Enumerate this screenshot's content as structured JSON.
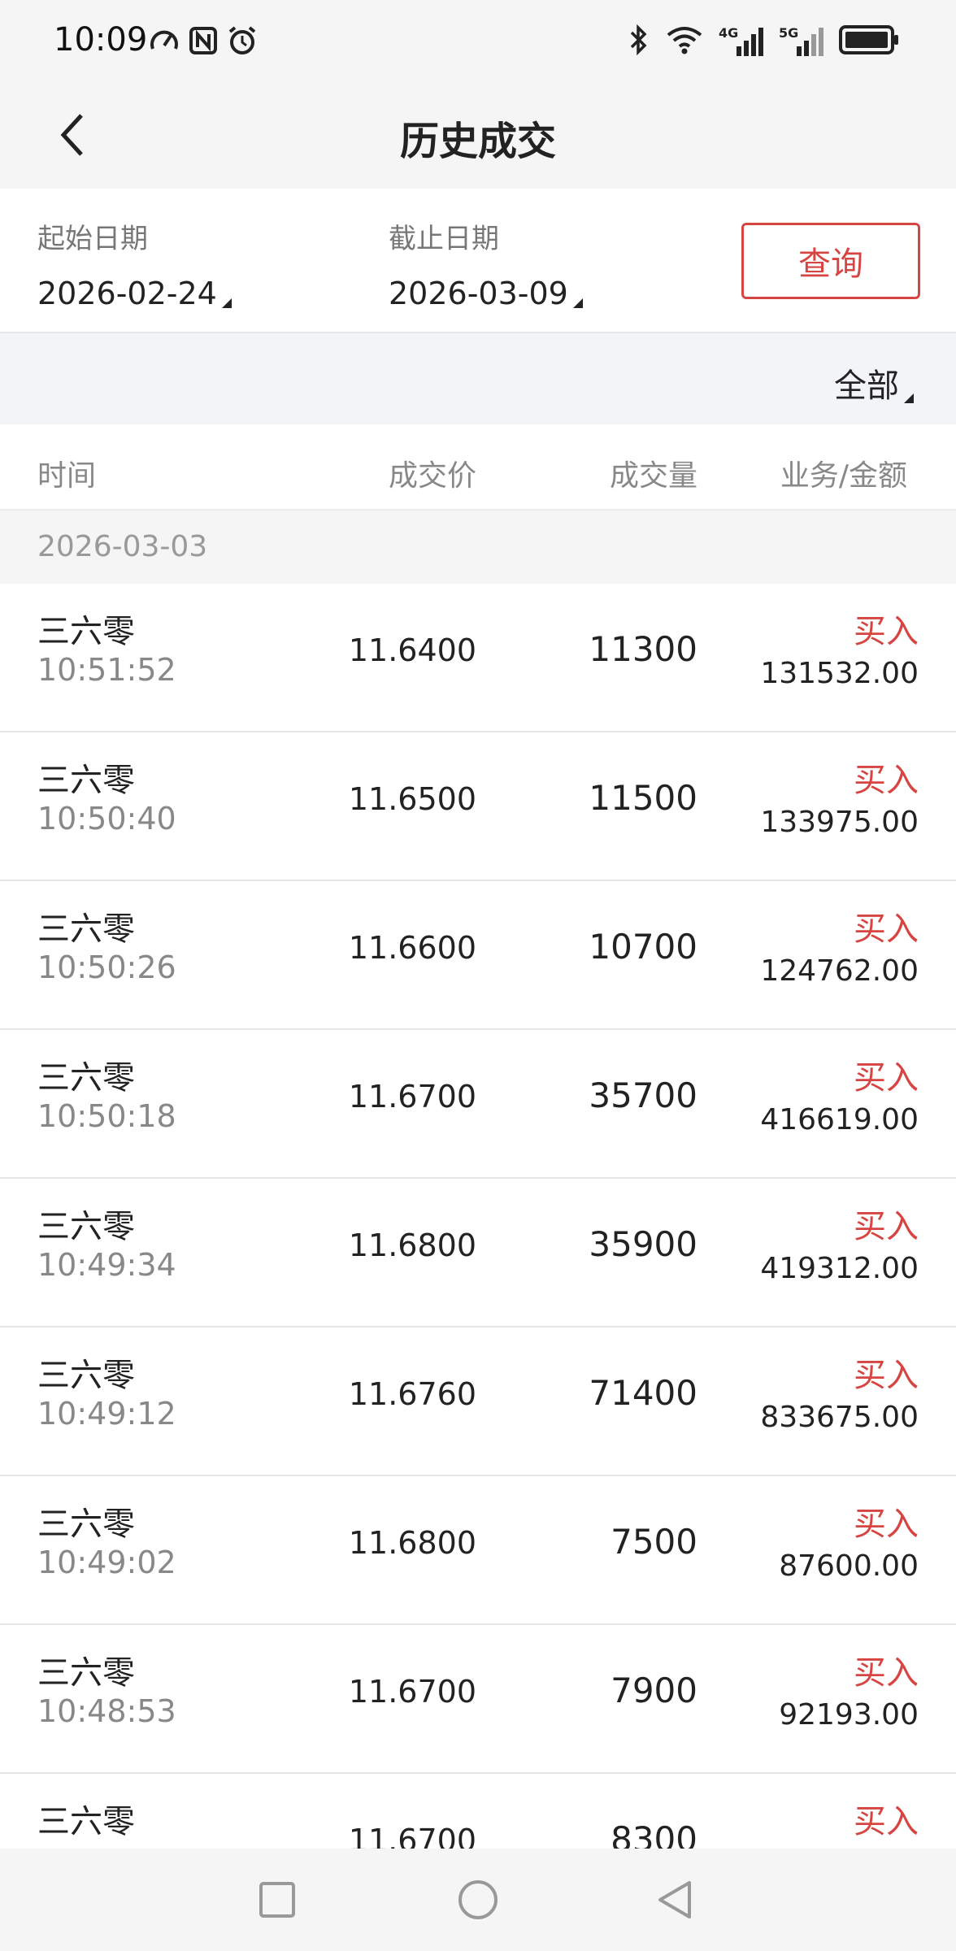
{
  "status_bar": {
    "time": "10:09",
    "icons_left": [
      "speedometer-icon",
      "nfc-icon",
      "alarm-icon"
    ],
    "icons_right": [
      "bluetooth-icon",
      "wifi-icon",
      "signal-4g-icon",
      "signal-5g-icon",
      "battery-icon"
    ],
    "signal_4g_label": "4G",
    "signal_5g_label": "5G"
  },
  "nav": {
    "title": "历史成交",
    "back_icon": "chevron-left-icon"
  },
  "date_filter": {
    "start_label": "起始日期",
    "start_value": "2026-02-24",
    "end_label": "截止日期",
    "end_value": "2026-03-09",
    "query_label": "查询"
  },
  "filter": {
    "selected": "全部"
  },
  "table": {
    "headers": {
      "time": "时间",
      "price": "成交价",
      "volume": "成交量",
      "business": "业务/金额"
    },
    "group_date": "2026-03-03",
    "rows": [
      {
        "name": "三六零",
        "time": "10:51:52",
        "price": "11.6400",
        "volume": "11300",
        "business": "买入",
        "amount": "131532.00"
      },
      {
        "name": "三六零",
        "time": "10:50:40",
        "price": "11.6500",
        "volume": "11500",
        "business": "买入",
        "amount": "133975.00"
      },
      {
        "name": "三六零",
        "time": "10:50:26",
        "price": "11.6600",
        "volume": "10700",
        "business": "买入",
        "amount": "124762.00"
      },
      {
        "name": "三六零",
        "time": "10:50:18",
        "price": "11.6700",
        "volume": "35700",
        "business": "买入",
        "amount": "416619.00"
      },
      {
        "name": "三六零",
        "time": "10:49:34",
        "price": "11.6800",
        "volume": "35900",
        "business": "买入",
        "amount": "419312.00"
      },
      {
        "name": "三六零",
        "time": "10:49:12",
        "price": "11.6760",
        "volume": "71400",
        "business": "买入",
        "amount": "833675.00"
      },
      {
        "name": "三六零",
        "time": "10:49:02",
        "price": "11.6800",
        "volume": "7500",
        "business": "买入",
        "amount": "87600.00"
      },
      {
        "name": "三六零",
        "time": "10:48:53",
        "price": "11.6700",
        "volume": "7900",
        "business": "买入",
        "amount": "92193.00"
      },
      {
        "name": "三六零",
        "time": "",
        "price": "11.6700",
        "volume": "8300",
        "business": "买入",
        "amount": ""
      }
    ]
  },
  "bottom_nav": {
    "icons": [
      "recent-apps-icon",
      "home-icon",
      "back-icon"
    ]
  },
  "colors": {
    "accent_red": "#d64541",
    "header_bg": "#f5f5f5",
    "filter_bg": "#f3f4f8"
  }
}
